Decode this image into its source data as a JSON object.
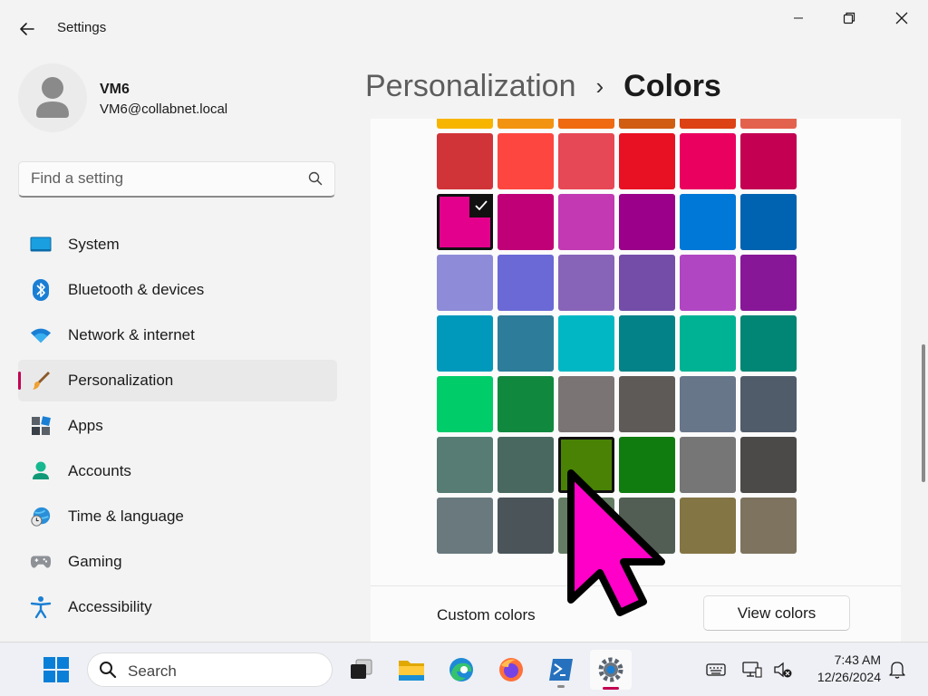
{
  "window": {
    "title": "Settings"
  },
  "profile": {
    "name": "VM6",
    "email": "VM6@collabnet.local"
  },
  "search": {
    "placeholder": "Find a setting"
  },
  "nav": {
    "items": [
      {
        "label": "System",
        "icon": "system-icon",
        "active": false
      },
      {
        "label": "Bluetooth & devices",
        "icon": "bluetooth-icon",
        "active": false
      },
      {
        "label": "Network & internet",
        "icon": "wifi-icon",
        "active": false
      },
      {
        "label": "Personalization",
        "icon": "brush-icon",
        "active": true
      },
      {
        "label": "Apps",
        "icon": "apps-icon",
        "active": false
      },
      {
        "label": "Accounts",
        "icon": "accounts-icon",
        "active": false
      },
      {
        "label": "Time & language",
        "icon": "globe-clock-icon",
        "active": false
      },
      {
        "label": "Gaming",
        "icon": "gamepad-icon",
        "active": false
      },
      {
        "label": "Accessibility",
        "icon": "accessibility-icon",
        "active": false
      }
    ]
  },
  "breadcrumb": {
    "parent": "Personalization",
    "separator": "›",
    "current": "Colors"
  },
  "palette": {
    "rows": [
      [
        "#f7b500",
        "#f29411",
        "#ef6a10",
        "#d05d12",
        "#dd4214",
        "#e3624e"
      ],
      [
        "#d13438",
        "#fe4640",
        "#e74856",
        "#e81123",
        "#ea005e",
        "#c30052"
      ],
      [
        "#e3008c",
        "#bf0077",
        "#c239b3",
        "#9a0089",
        "#0078d7",
        "#0063b1"
      ],
      [
        "#8e8cd8",
        "#6b69d6",
        "#8764b8",
        "#744da9",
        "#b146c2",
        "#881798"
      ],
      [
        "#0099bc",
        "#2d7d9a",
        "#00b7c3",
        "#038387",
        "#00b294",
        "#018574"
      ],
      [
        "#00cc6a",
        "#10893e",
        "#7a7574",
        "#5d5a58",
        "#68768a",
        "#515c6b"
      ],
      [
        "#567c73",
        "#486860",
        "#498205",
        "#107c10",
        "#767676",
        "#4c4a48"
      ],
      [
        "#69797e",
        "#4a5459",
        "#647c64",
        "#525e54",
        "#847545",
        "#7e735f"
      ]
    ],
    "selected": {
      "row": 2,
      "col": 0
    },
    "hovered": {
      "row": 6,
      "col": 2
    }
  },
  "custom_colors": {
    "label": "Custom colors",
    "button_label": "View colors"
  },
  "taskbar": {
    "search_label": "Search",
    "time": "7:43 AM",
    "date": "12/26/2024",
    "apps": [
      "windows-start-icon",
      "task-view-icon",
      "file-explorer-icon",
      "edge-icon",
      "firefox-icon",
      "powershell-icon",
      "settings-icon"
    ],
    "tray": [
      "keyboard-icon",
      "network-display-icon",
      "volume-muted-icon",
      "notification-bell-icon"
    ]
  },
  "colors": {
    "accent": "#c30052",
    "cursor": "#ff00c8"
  }
}
